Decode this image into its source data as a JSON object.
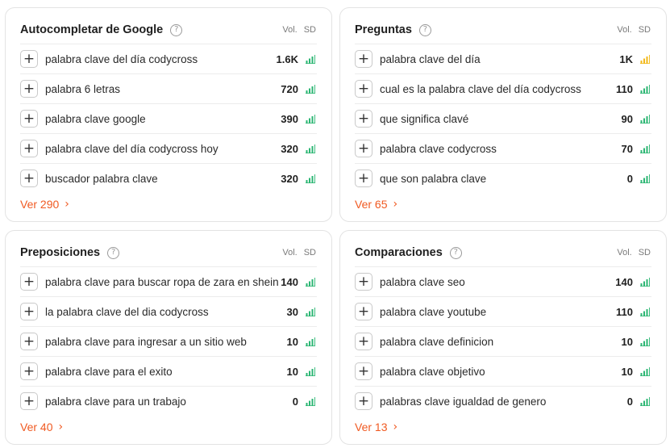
{
  "columns": {
    "vol": "Vol.",
    "sd": "SD"
  },
  "colors": {
    "accent": "#f05a22",
    "sd_green": "#2bb673",
    "sd_yellow": "#f2b81a"
  },
  "cards": [
    {
      "title": "Autocompletar de Google",
      "more": "Ver 290",
      "rows": [
        {
          "keyword": "palabra clave del día codycross",
          "volume": "1.6K",
          "sd": "green"
        },
        {
          "keyword": "palabra 6 letras",
          "volume": "720",
          "sd": "green"
        },
        {
          "keyword": "palabra clave google",
          "volume": "390",
          "sd": "green"
        },
        {
          "keyword": "palabra clave del día codycross hoy",
          "volume": "320",
          "sd": "green"
        },
        {
          "keyword": "buscador palabra clave",
          "volume": "320",
          "sd": "green"
        }
      ]
    },
    {
      "title": "Preguntas",
      "more": "Ver 65",
      "rows": [
        {
          "keyword": "palabra clave del día",
          "volume": "1K",
          "sd": "yellow"
        },
        {
          "keyword": "cual es la palabra clave del día codycross",
          "volume": "110",
          "sd": "green"
        },
        {
          "keyword": "que significa clavé",
          "volume": "90",
          "sd": "green"
        },
        {
          "keyword": "palabra clave codycross",
          "volume": "70",
          "sd": "green"
        },
        {
          "keyword": "que son palabra clave",
          "volume": "0",
          "sd": "green"
        }
      ]
    },
    {
      "title": "Preposiciones",
      "more": "Ver 40",
      "rows": [
        {
          "keyword": "palabra clave para buscar ropa de zara en shein",
          "volume": "140",
          "sd": "green"
        },
        {
          "keyword": "la palabra clave del dia codycross",
          "volume": "30",
          "sd": "green"
        },
        {
          "keyword": "palabra clave para ingresar a un sitio web",
          "volume": "10",
          "sd": "green"
        },
        {
          "keyword": "palabra clave para el exito",
          "volume": "10",
          "sd": "green"
        },
        {
          "keyword": "palabra clave para un trabajo",
          "volume": "0",
          "sd": "green"
        }
      ]
    },
    {
      "title": "Comparaciones",
      "more": "Ver 13",
      "rows": [
        {
          "keyword": "palabra clave seo",
          "volume": "140",
          "sd": "green"
        },
        {
          "keyword": "palabra clave youtube",
          "volume": "110",
          "sd": "green"
        },
        {
          "keyword": "palabra clave definicion",
          "volume": "10",
          "sd": "green"
        },
        {
          "keyword": "palabra clave objetivo",
          "volume": "10",
          "sd": "green"
        },
        {
          "keyword": "palabras clave igualdad de genero",
          "volume": "0",
          "sd": "green"
        }
      ]
    }
  ]
}
